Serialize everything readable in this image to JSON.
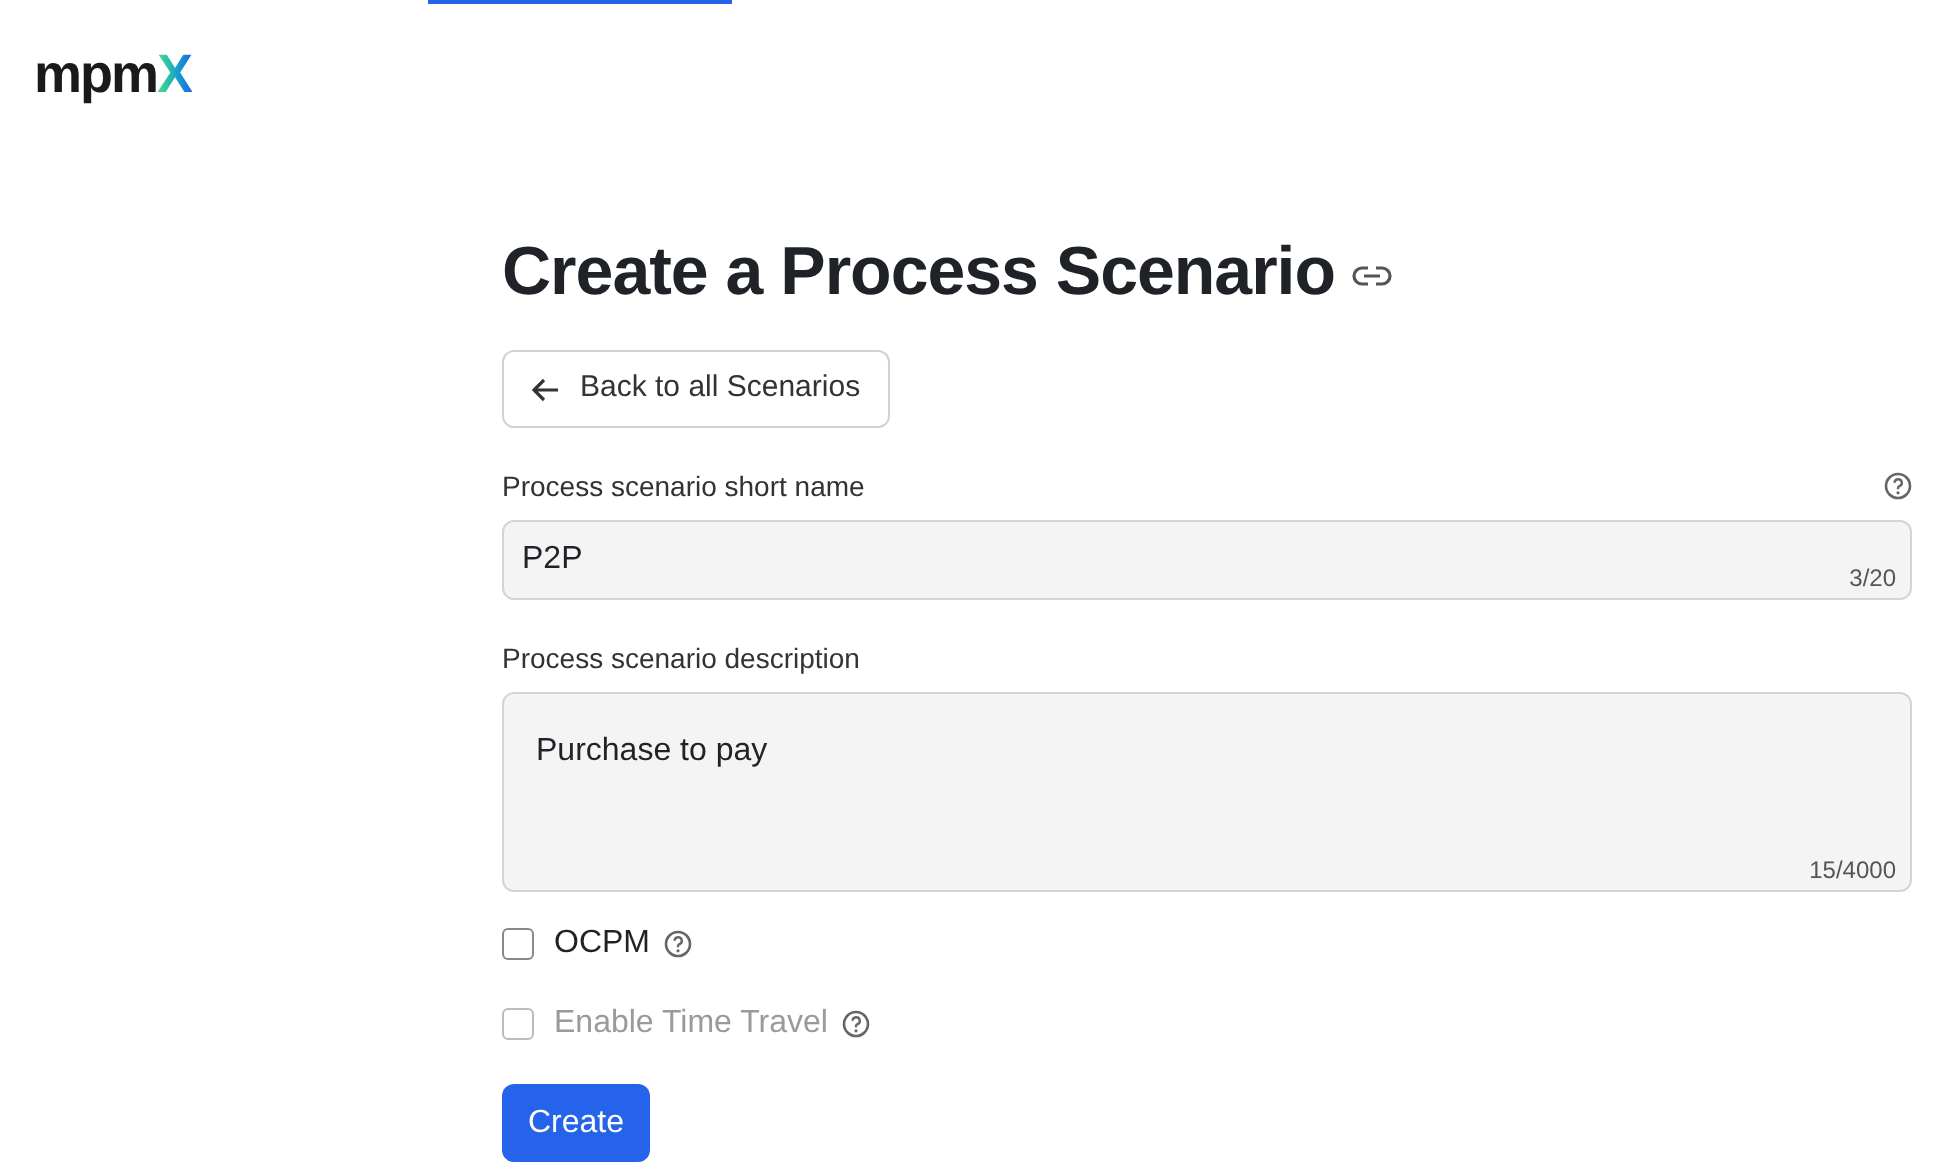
{
  "logo": {
    "text": "mpm",
    "accent": "X"
  },
  "title": "Create a Process Scenario",
  "back_button": {
    "label": "Back to all Scenarios"
  },
  "fields": [
    {
      "kind": "input",
      "label": "Process scenario short name",
      "help": true,
      "value": "P2P",
      "counter": "3/20"
    },
    {
      "kind": "textarea",
      "label": "Process scenario description",
      "help": false,
      "value": "Purchase to pay",
      "counter": "15/4000"
    }
  ],
  "checkboxes": [
    {
      "label": "OCPM",
      "checked": false,
      "disabled": false
    },
    {
      "label": "Enable Time Travel",
      "checked": false,
      "disabled": true
    }
  ],
  "submit_button": {
    "label": "Create"
  }
}
